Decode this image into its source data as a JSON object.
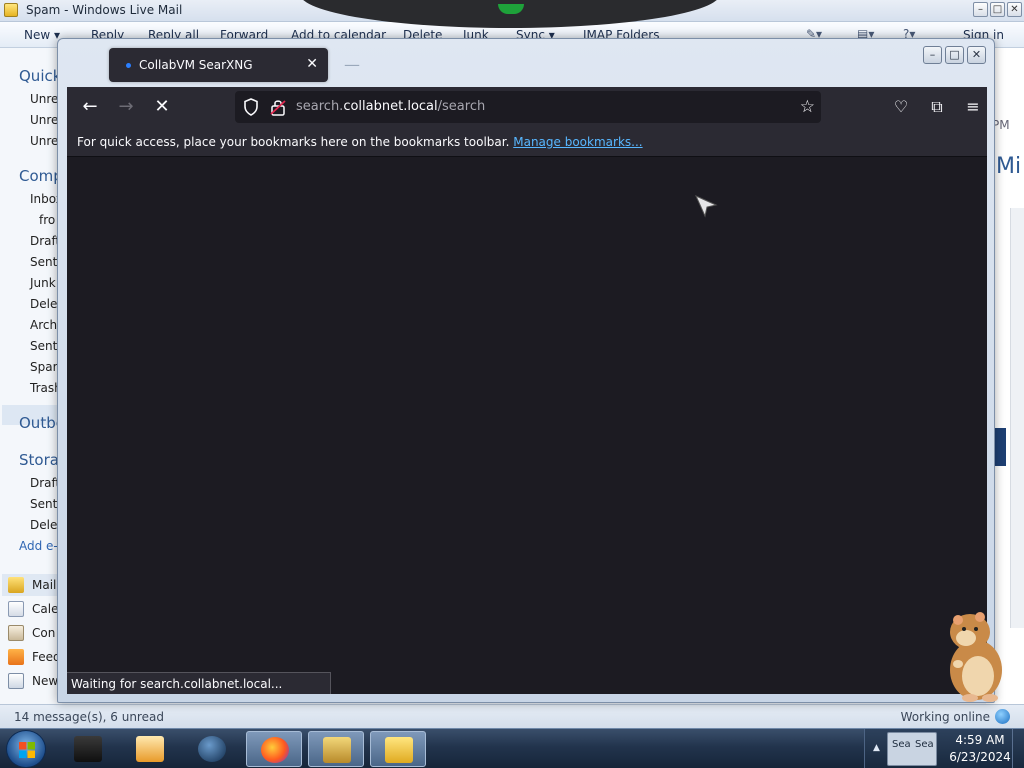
{
  "wlm": {
    "title": "Spam - Windows Live Mail",
    "toolbar": {
      "new": "New",
      "reply": "Reply",
      "reply_all": "Reply all",
      "forward": "Forward",
      "add_to_calendar": "Add to calendar",
      "delete": "Delete",
      "junk": "Junk",
      "sync": "Sync",
      "imap_folders": "IMAP Folders",
      "sign_in": "Sign in"
    },
    "nav": {
      "quick_views": "Quick",
      "quick_items": [
        "Unre",
        "Unre",
        "Unre"
      ],
      "account": "Comp",
      "account_items": [
        "Inbox",
        "fro",
        "Draft",
        "Sent",
        "Junk",
        "Delet",
        "Archi",
        "Sent",
        "Spam",
        "Trash"
      ],
      "outbox": "Outbo",
      "storage": "Storag",
      "storage_items": [
        "Draft",
        "Sent",
        "Delet"
      ],
      "add_account": "Add e-",
      "modules": [
        "Mail",
        "Cale",
        "Con",
        "Feed",
        "New"
      ]
    },
    "right_fragments": [
      "PM",
      "Mi"
    ],
    "status_left": "14 message(s), 6 unread",
    "status_right": "Working online"
  },
  "firefox": {
    "tab_title": "CollabVM SearXNG",
    "address_host_prefix": "search.",
    "address_domain": "collabnet.local",
    "address_path": "/search",
    "bookmarks_message": "For quick access, place your bookmarks here on the bookmarks toolbar.",
    "manage_bookmarks": "Manage bookmarks...",
    "status_text": "Waiting for search.collabnet.local..."
  },
  "taskbar": {
    "time": "4:59 AM",
    "date": "6/23/2024",
    "tray_labels": [
      "Sea",
      "Sea"
    ]
  },
  "colors": {
    "ff_chrome": "#2b2a33",
    "ff_content": "#1c1b22",
    "link": "#58b7ff",
    "wlm_accent": "#2f5a93"
  }
}
